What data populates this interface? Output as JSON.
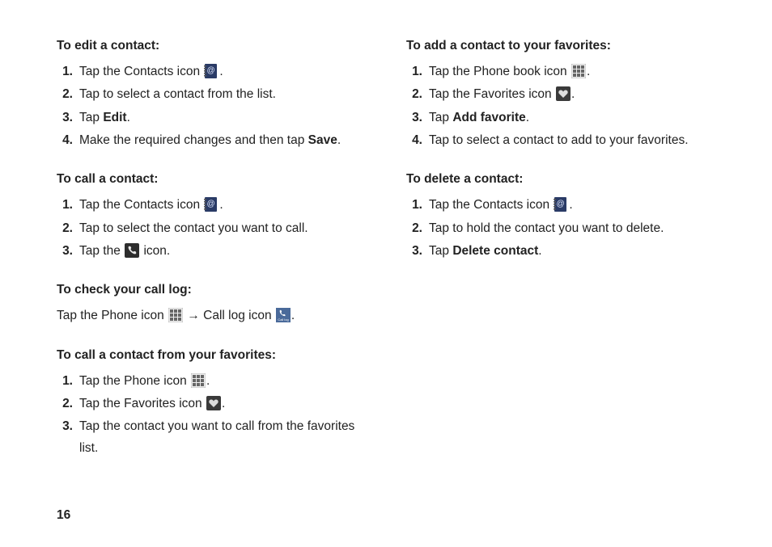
{
  "pageNumber": "16",
  "arrow": "→",
  "left": {
    "sections": [
      {
        "heading": "To edit a contact:",
        "steps": [
          {
            "pre": "Tap the Contacts icon ",
            "icon": "contacts-icon",
            "post": "."
          },
          {
            "pre": "Tap to select a contact from the list."
          },
          {
            "pre": "Tap ",
            "bold": "Edit",
            "post": "."
          },
          {
            "pre": "Make the required changes and then tap ",
            "bold": "Save",
            "post": "."
          }
        ]
      },
      {
        "heading": "To call a contact:",
        "steps": [
          {
            "pre": "Tap the Contacts icon ",
            "icon": "contacts-icon",
            "post": "."
          },
          {
            "pre": "Tap to select the contact you want to call."
          },
          {
            "pre": "Tap the ",
            "icon": "call-icon",
            "post": " icon."
          }
        ]
      },
      {
        "heading": "To check your call log:",
        "plain": {
          "pre": "Tap the Phone icon ",
          "icon1": "keypad-icon",
          "mid": " → Call log icon ",
          "icon2": "calllog-icon",
          "post": "."
        }
      },
      {
        "heading": "To call a contact from your favorites:",
        "steps": [
          {
            "pre": "Tap the Phone icon ",
            "icon": "keypad-icon",
            "post": "."
          },
          {
            "pre": "Tap the Favorites icon ",
            "icon": "heart-icon",
            "post": "."
          },
          {
            "pre": "Tap the contact you want to call from the favorites list."
          }
        ]
      }
    ]
  },
  "right": {
    "sections": [
      {
        "heading": "To add a contact to your favorites:",
        "steps": [
          {
            "pre": "Tap the Phone book icon ",
            "icon": "keypad-icon",
            "post": "."
          },
          {
            "pre": "Tap the Favorites icon ",
            "icon": "heart-icon",
            "post": "."
          },
          {
            "pre": "Tap ",
            "bold": "Add favorite",
            "post": "."
          },
          {
            "pre": "Tap to select a contact to add to your favorites."
          }
        ]
      },
      {
        "heading": "To delete a contact:",
        "steps": [
          {
            "pre": "Tap the Contacts icon ",
            "icon": "contacts-icon",
            "post": "."
          },
          {
            "pre": "Tap to hold the contact you want to delete."
          },
          {
            "pre": "Tap ",
            "bold": "Delete contact",
            "post": "."
          }
        ]
      }
    ]
  }
}
